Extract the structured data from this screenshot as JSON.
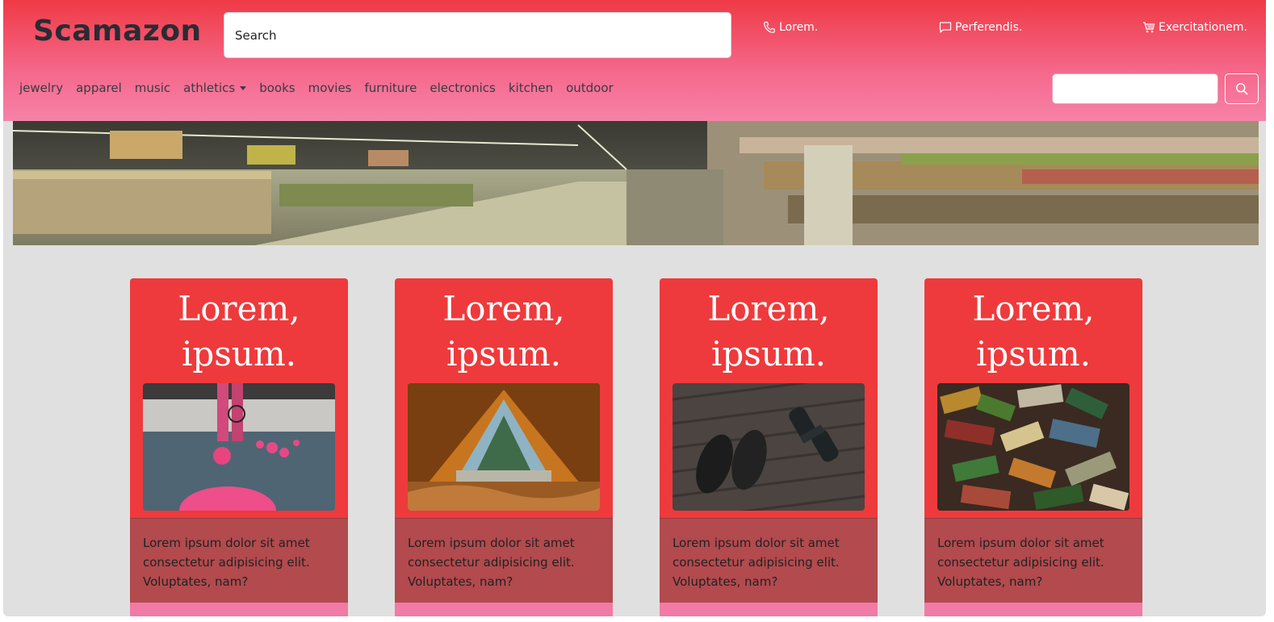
{
  "brand": "Scamazon",
  "search": {
    "label": "Search"
  },
  "top_links": [
    {
      "label": "Lorem.",
      "icon": "phone-icon"
    },
    {
      "label": "Perferendis.",
      "icon": "chat-icon"
    },
    {
      "label": "Exercitationem.",
      "icon": "cart-icon"
    }
  ],
  "nav": {
    "items": [
      "jewelry",
      "apparel",
      "music",
      "athletics",
      "books",
      "movies",
      "furniture",
      "electronics",
      "kitchen",
      "outdoor"
    ],
    "dropdown_item": "athletics"
  },
  "cards": [
    {
      "title_line1": "Lorem,",
      "title_line2": "ipsum.",
      "image": "tennis-balls-photo",
      "text": "Lorem ipsum dolor sit amet consectetur adipisicing elit. Voluptates, nam?"
    },
    {
      "title_line1": "Lorem,",
      "title_line2": "ipsum.",
      "image": "tent-photo",
      "text": "Lorem ipsum dolor sit amet consectetur adipisicing elit. Voluptates, nam?"
    },
    {
      "title_line1": "Lorem,",
      "title_line2": "ipsum.",
      "image": "shoes-dumbbell-photo",
      "text": "Lorem ipsum dolor sit amet consectetur adipisicing elit. Voluptates, nam?"
    },
    {
      "title_line1": "Lorem,",
      "title_line2": "ipsum.",
      "image": "books-pile-photo",
      "text": "Lorem ipsum dolor sit amet consectetur adipisicing elit. Voluptates, nam?"
    }
  ],
  "colors": {
    "header_top": "#ef3a45",
    "header_bottom": "#f682a8",
    "card_bg": "#ee3a3c",
    "card_body_bg": "#b24a4e",
    "page_bg": "#e0e0e0"
  }
}
